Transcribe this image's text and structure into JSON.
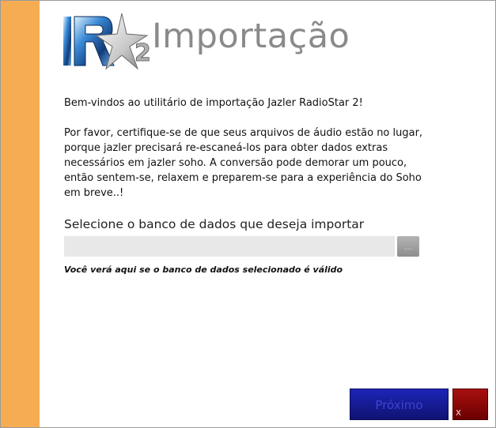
{
  "header": {
    "title": "Importação"
  },
  "intro": {
    "welcome": "Bem-vindos ao utilitário de importação Jazler RadioStar 2!",
    "instructions": "Por favor, certifique-se de que seus arquivos de áudio estão no lugar, porque jazler precisará re-escaneá-los para obter dados extras necessários em jazler soho. A conversão pode demorar um pouco, então sentem-se, relaxem e preparem-se para a experiência do Soho em breve..!"
  },
  "database": {
    "label": "Selecione o banco de dados que deseja importar",
    "value": "",
    "browse_label": "...",
    "validity_message": "Você verá aqui se o banco de dados selecionado é válido"
  },
  "footer": {
    "next_label": "Próximo",
    "close_label": "x"
  },
  "colors": {
    "sidebar": "#f5ac52",
    "next_button": "#1d24b6",
    "close_button": "#a81010",
    "title": "#8a8a8a"
  }
}
